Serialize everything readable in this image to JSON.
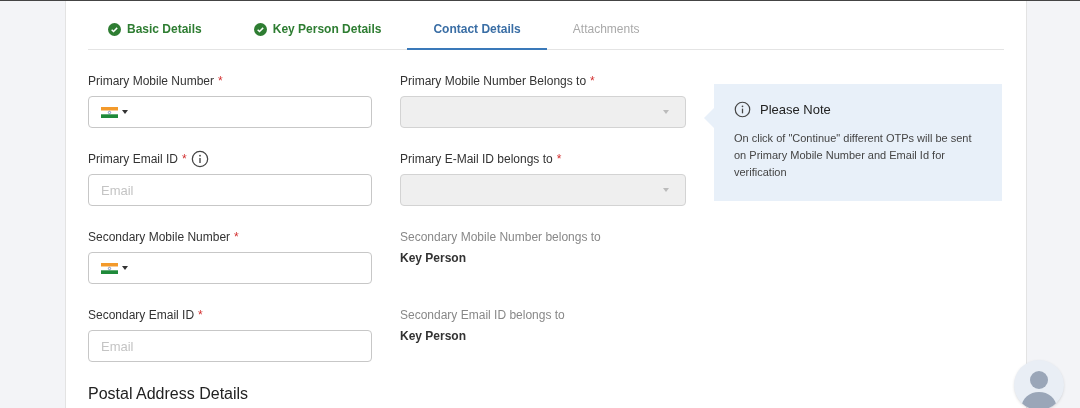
{
  "tabs": [
    {
      "label": "Basic Details",
      "completed": true,
      "selected": false,
      "disabled": false
    },
    {
      "label": "Key Person Details",
      "completed": true,
      "selected": false,
      "disabled": false
    },
    {
      "label": "Contact Details",
      "completed": false,
      "selected": true,
      "disabled": false
    },
    {
      "label": "Attachments",
      "completed": false,
      "selected": false,
      "disabled": true
    }
  ],
  "rows": [
    {
      "left": {
        "label": "Primary Mobile Number",
        "required_mark": "*",
        "kind": "phone"
      },
      "right": {
        "label": "Primary Mobile Number Belongs to",
        "required_mark": "*",
        "kind": "select",
        "disabled": true
      }
    },
    {
      "left": {
        "label": "Primary Email ID",
        "required_mark": "*",
        "info": true,
        "kind": "email",
        "placeholder": "Email"
      },
      "right": {
        "label": "Primary E-Mail ID belongs to",
        "required_mark": "*",
        "kind": "select",
        "disabled": true
      }
    },
    {
      "left": {
        "label": "Secondary Mobile Number",
        "required_mark": "*",
        "kind": "phone"
      },
      "right": {
        "label": "Secondary Mobile Number belongs to",
        "kind": "readonly",
        "value": "Key Person"
      }
    },
    {
      "left": {
        "label": "Secondary Email ID",
        "required_mark": "*",
        "kind": "email",
        "placeholder": "Email"
      },
      "right": {
        "label": "Secondary Email ID belongs to",
        "kind": "readonly",
        "value": "Key Person"
      }
    }
  ],
  "note": {
    "title": "Please Note",
    "text": "On click of \"Continue\" different OTPs will be sent on Primary Mobile Number and Email Id for verification"
  },
  "section_heading": "Postal Address Details"
}
